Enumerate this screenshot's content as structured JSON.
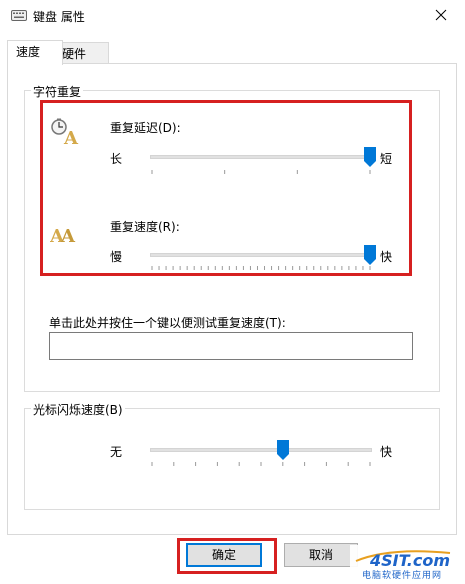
{
  "window": {
    "title": "键盘 属性",
    "close_icon": "close-icon"
  },
  "tabs": [
    {
      "label": "速度",
      "active": true
    },
    {
      "label": "硬件",
      "active": false
    }
  ],
  "char_repeat": {
    "group_title": "字符重复",
    "delay": {
      "label": "重复延迟(D):",
      "min_label": "长",
      "max_label": "短",
      "value_fraction": 1.0,
      "icon": "repeat-delay-icon"
    },
    "rate": {
      "label": "重复速度(R):",
      "min_label": "慢",
      "max_label": "快",
      "value_fraction": 1.0,
      "icon": "repeat-rate-icon"
    },
    "test_label": "单击此处并按住一个键以便测试重复速度(T):",
    "test_value": ""
  },
  "cursor_blink": {
    "group_title": "光标闪烁速度(B)",
    "min_label": "无",
    "max_label": "快",
    "value_fraction": 0.6
  },
  "buttons": {
    "ok": "确定",
    "cancel": "取消"
  },
  "watermark": {
    "logo": "4SIT.com",
    "tagline": "电脑软硬件应用网"
  },
  "colors": {
    "highlight": "#d62020",
    "thumb": "#0078d7",
    "watermark_blue": "#1e64c8"
  }
}
